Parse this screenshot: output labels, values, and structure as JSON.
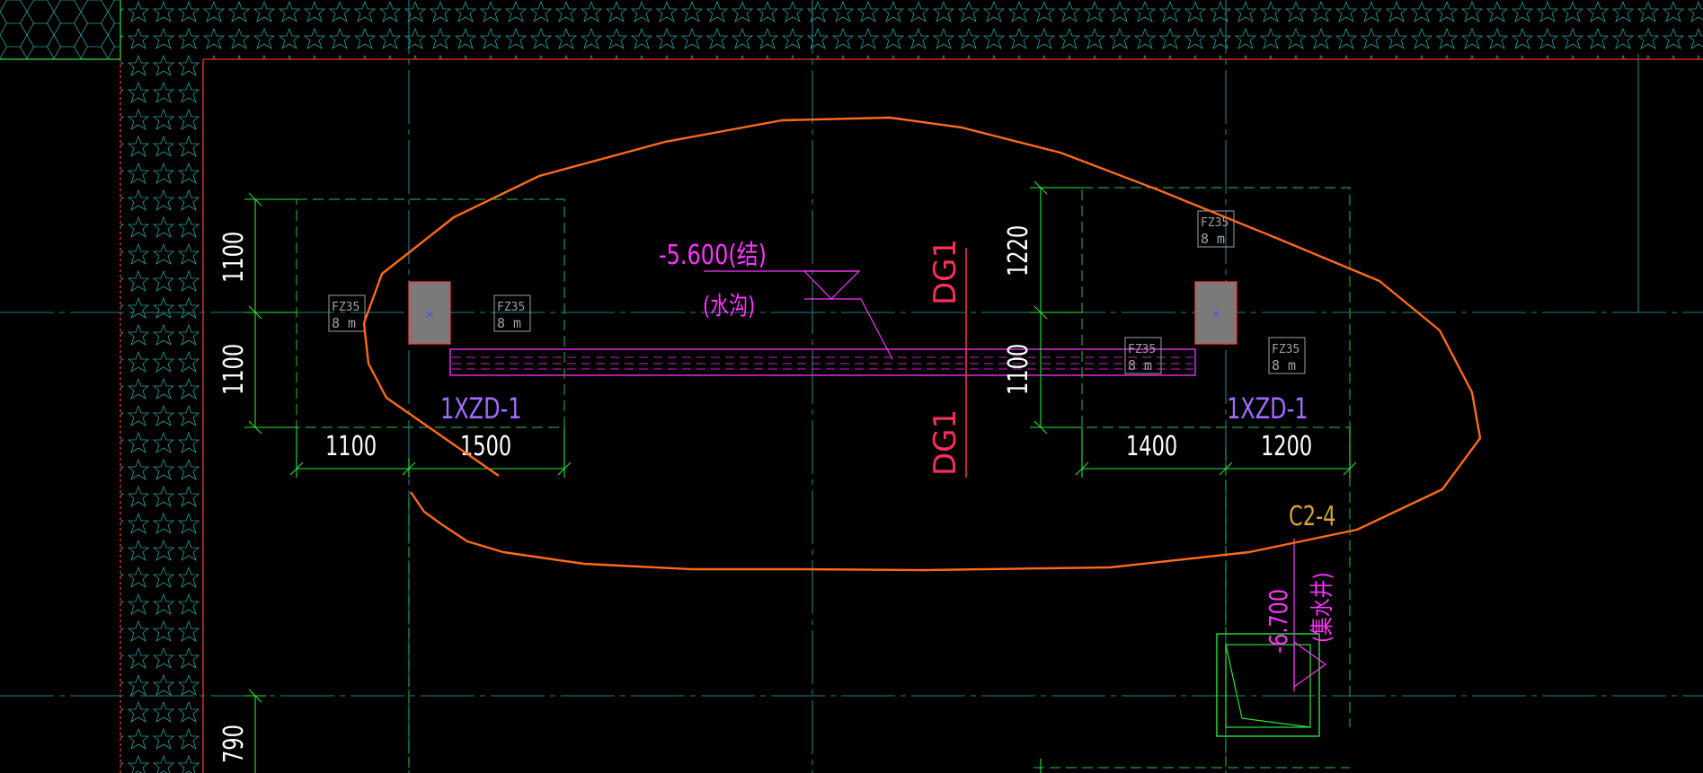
{
  "drawing": {
    "colors": {
      "background": "#000000",
      "axis": "#1f7f86",
      "wall": "#ff2a2a",
      "green": "#27e33a",
      "dash_green": "#1fa03a",
      "magenta": "#ff33ff",
      "purple": "#a26cff",
      "orange": "#ff6a1a",
      "red_label": "#ff2f5a",
      "gold": "#d8a23a",
      "hatch": "#2aa0a0",
      "column_fill": "#7a7a7a",
      "column_edge": "#ff3c3c",
      "grey_text": "#a0a0a0"
    },
    "elevation_label": "-5.600(结)",
    "trench_label": "(水沟)",
    "beam_label": "DG1",
    "left_footing": {
      "label": "1XZD-1",
      "dim_top": "1100",
      "dim_bottom": "1100",
      "dim_left": "1100",
      "dim_right": "1500"
    },
    "right_footing": {
      "label": "1XZD-1",
      "dim_top": "1220",
      "dim_bottom": "1100",
      "dim_left": "1400",
      "dim_right": "1200"
    },
    "pit_label": "C2-4",
    "sump_elevation": "-6.700",
    "sump_label": "(集水井)",
    "lower_dim": "790",
    "tag_main": "FZ35",
    "tag_sub": "8 m"
  }
}
